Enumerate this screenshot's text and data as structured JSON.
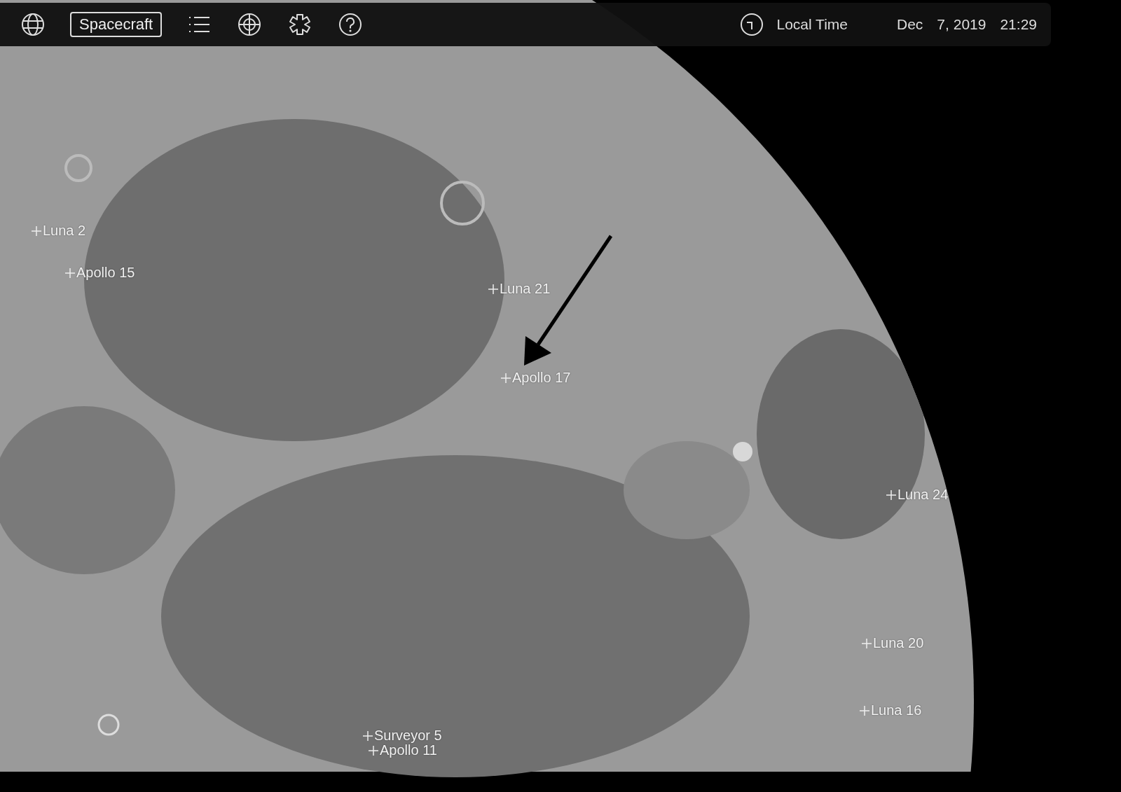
{
  "toolbar": {
    "mode_button": "Spacecraft",
    "time_mode": "Local Time",
    "date": "Dec",
    "date_rest": "7, 2019",
    "time": "21:29"
  },
  "landing_sites": [
    {
      "name": "Luna 2"
    },
    {
      "name": "Apollo 15"
    },
    {
      "name": "Luna 21"
    },
    {
      "name": "Apollo 17"
    },
    {
      "name": "Luna 24"
    },
    {
      "name": "Luna 20"
    },
    {
      "name": "Luna 16"
    },
    {
      "name": "Surveyor 5"
    },
    {
      "name": "Apollo 11"
    }
  ]
}
